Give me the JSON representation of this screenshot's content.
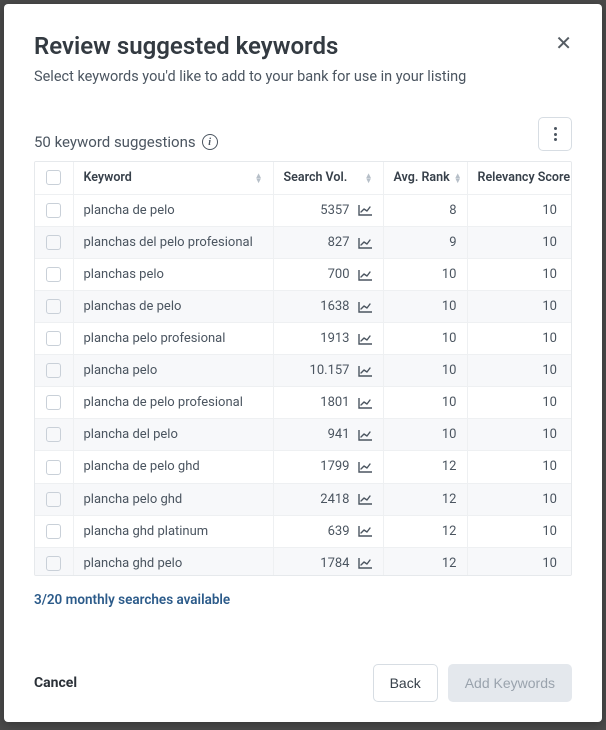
{
  "header": {
    "title": "Review suggested keywords",
    "subtitle": "Select keywords you'd like to add to your bank for use in your listing"
  },
  "suggestions": {
    "count_label": "50 keyword suggestions"
  },
  "table": {
    "columns": {
      "keyword": "Keyword",
      "search_vol": "Search Vol.",
      "avg_rank": "Avg. Rank",
      "relevancy": "Relevancy Score"
    },
    "rows": [
      {
        "keyword": "plancha de pelo",
        "volume": "5357",
        "rank": "8",
        "relevancy": "10"
      },
      {
        "keyword": "planchas del pelo profesional",
        "volume": "827",
        "rank": "9",
        "relevancy": "10"
      },
      {
        "keyword": "planchas pelo",
        "volume": "700",
        "rank": "10",
        "relevancy": "10"
      },
      {
        "keyword": "planchas de pelo",
        "volume": "1638",
        "rank": "10",
        "relevancy": "10"
      },
      {
        "keyword": "plancha pelo profesional",
        "volume": "1913",
        "rank": "10",
        "relevancy": "10"
      },
      {
        "keyword": "plancha pelo",
        "volume": "10.157",
        "rank": "10",
        "relevancy": "10"
      },
      {
        "keyword": "plancha de pelo profesional",
        "volume": "1801",
        "rank": "10",
        "relevancy": "10"
      },
      {
        "keyword": "plancha del pelo",
        "volume": "941",
        "rank": "10",
        "relevancy": "10"
      },
      {
        "keyword": "plancha de pelo ghd",
        "volume": "1799",
        "rank": "12",
        "relevancy": "10"
      },
      {
        "keyword": "plancha pelo ghd",
        "volume": "2418",
        "rank": "12",
        "relevancy": "10"
      },
      {
        "keyword": "plancha ghd platinum",
        "volume": "639",
        "rank": "12",
        "relevancy": "10"
      },
      {
        "keyword": "plancha ghd pelo",
        "volume": "1784",
        "rank": "12",
        "relevancy": "10"
      }
    ]
  },
  "searches_available": "3/20 monthly searches available",
  "footer": {
    "cancel": "Cancel",
    "back": "Back",
    "add": "Add Keywords"
  }
}
